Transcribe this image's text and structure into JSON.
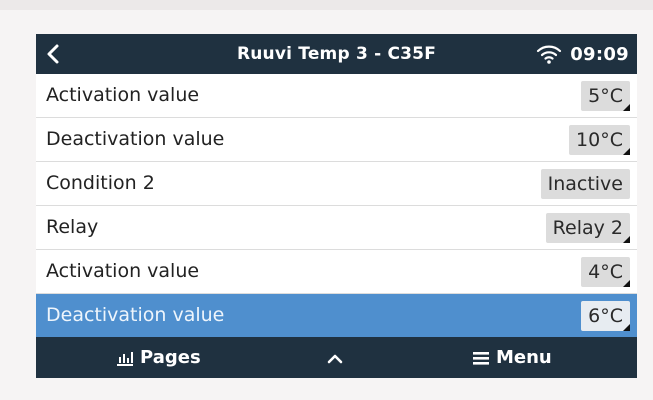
{
  "header": {
    "title": "Ruuvi Temp 3 - C35F",
    "time": "09:09"
  },
  "rows": [
    {
      "label": "Activation value",
      "value": "5°C"
    },
    {
      "label": "Deactivation value",
      "value": "10°C"
    },
    {
      "label": "Condition 2",
      "value": "Inactive"
    },
    {
      "label": "Relay",
      "value": "Relay 2"
    },
    {
      "label": "Activation value",
      "value": "4°C"
    },
    {
      "label": "Deactivation value",
      "value": "6°C"
    }
  ],
  "footer": {
    "pages_label": "Pages",
    "menu_label": "Menu"
  },
  "colors": {
    "bar_background": "#1f3140",
    "selected_row": "#4f8fce"
  },
  "icons": [
    "back-icon",
    "wifi-icon",
    "pages-icon",
    "chevron-up-icon",
    "menu-icon"
  ]
}
